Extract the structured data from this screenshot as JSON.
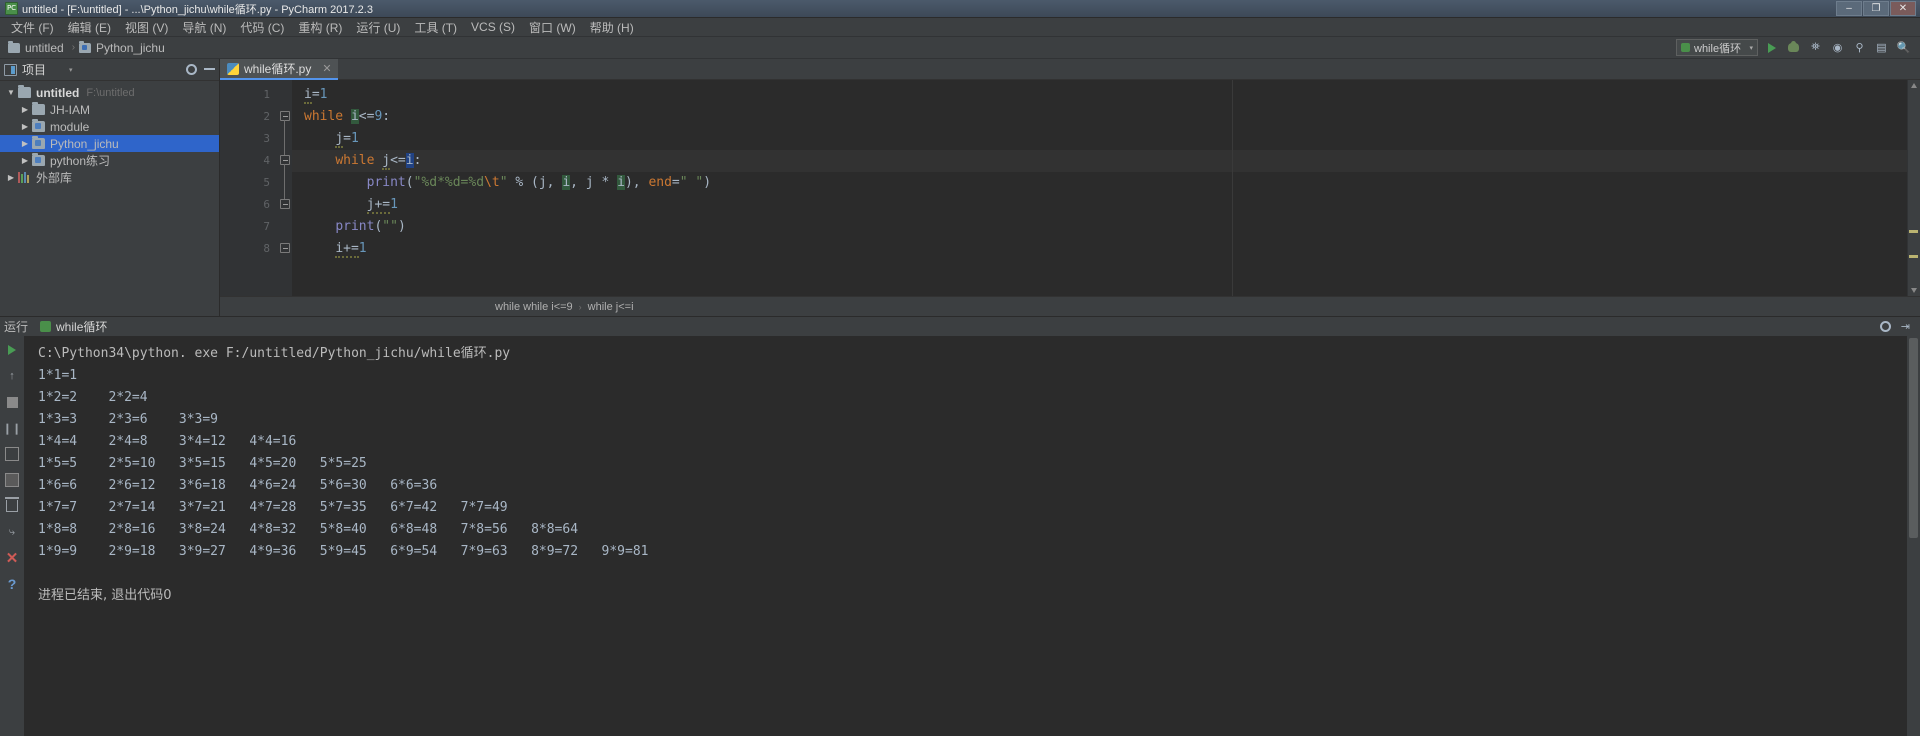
{
  "window": {
    "title": "untitled - [F:\\untitled] - ...\\Python_jichu\\while循环.py - PyCharm 2017.2.3",
    "app_icon": "pycharm-icon",
    "minimize": "–",
    "maximize": "❐",
    "close": "✕"
  },
  "menubar": {
    "items": [
      {
        "label": "文件 (F)",
        "name": "menu-file"
      },
      {
        "label": "编辑 (E)",
        "name": "menu-edit"
      },
      {
        "label": "视图 (V)",
        "name": "menu-view"
      },
      {
        "label": "导航 (N)",
        "name": "menu-navigate"
      },
      {
        "label": "代码 (C)",
        "name": "menu-code"
      },
      {
        "label": "重构 (R)",
        "name": "menu-refactor"
      },
      {
        "label": "运行 (U)",
        "name": "menu-run"
      },
      {
        "label": "工具 (T)",
        "name": "menu-tools"
      },
      {
        "label": "VCS (S)",
        "name": "menu-vcs"
      },
      {
        "label": "窗口 (W)",
        "name": "menu-window"
      },
      {
        "label": "帮助 (H)",
        "name": "menu-help"
      }
    ]
  },
  "navbar": {
    "crumbs": [
      {
        "label": "untitled",
        "icon": "folder-icon"
      },
      {
        "label": "Python_jichu",
        "icon": "source-folder-icon"
      }
    ],
    "separator": "›",
    "run_config": {
      "label": "while循环",
      "icon": "python-config-icon",
      "arrow": "▾"
    },
    "buttons": [
      {
        "name": "run-button",
        "icon": "play-icon"
      },
      {
        "name": "debug-button",
        "icon": "bug-icon"
      },
      {
        "name": "coverage-button",
        "icon": "coverage-icon"
      },
      {
        "name": "profile-button",
        "icon": "profile-icon"
      },
      {
        "name": "attach-button",
        "icon": "attach-icon"
      },
      {
        "name": "layout-button",
        "icon": "layout-icon"
      },
      {
        "name": "search-button",
        "icon": "search-icon"
      }
    ]
  },
  "sidebar": {
    "header": {
      "title": "项目",
      "caret": "▾",
      "icon": "project-panel-icon",
      "settings_icon": "gear-icon",
      "collapse_icon": "collapse-icon"
    },
    "tree": [
      {
        "label": "untitled",
        "sub": "F:\\untitled",
        "icon": "folder-icon",
        "twisty": "▼",
        "depth": 0,
        "bold": true,
        "selected": false
      },
      {
        "label": "JH-IAM",
        "sub": "",
        "icon": "folder-icon",
        "twisty": "▶",
        "depth": 1,
        "bold": false,
        "selected": false
      },
      {
        "label": "module",
        "sub": "",
        "icon": "source-folder-icon",
        "twisty": "▶",
        "depth": 1,
        "bold": false,
        "selected": false
      },
      {
        "label": "Python_jichu",
        "sub": "",
        "icon": "source-folder-icon",
        "twisty": "▶",
        "depth": 1,
        "bold": false,
        "selected": true
      },
      {
        "label": "python练习",
        "sub": "",
        "icon": "source-folder-icon",
        "twisty": "▶",
        "depth": 1,
        "bold": false,
        "selected": false
      },
      {
        "label": "外部库",
        "sub": "",
        "icon": "library-icon",
        "twisty": "▶",
        "depth": 0,
        "bold": false,
        "selected": false
      }
    ]
  },
  "editor": {
    "tab": {
      "label": "while循环.py",
      "icon": "python-file-icon",
      "close": "✕"
    },
    "gutter_lines": [
      "1",
      "2",
      "3",
      "4",
      "5",
      "6",
      "7",
      "8"
    ],
    "code": [
      {
        "n": 1,
        "text": "i=1",
        "current": false
      },
      {
        "n": 2,
        "text": "while i<=9:",
        "current": false
      },
      {
        "n": 3,
        "text": "    j=1",
        "current": false
      },
      {
        "n": 4,
        "text": "    while j<=i:",
        "current": true
      },
      {
        "n": 5,
        "text": "        print(\"%d*%d=%d\\t\" % (j, i, j * i), end=\" \")",
        "current": false
      },
      {
        "n": 6,
        "text": "        j+=1",
        "current": false
      },
      {
        "n": 7,
        "text": "    print(\"\")",
        "current": false
      },
      {
        "n": 8,
        "text": "    i+=1",
        "current": false
      }
    ],
    "breadcrumb": [
      "while i<=9",
      "while j<=i"
    ],
    "breadcrumb_separator": "›"
  },
  "run_panel": {
    "label": "运行",
    "tab_label": "while循环",
    "tab_icon": "python-run-icon",
    "settings_icon": "gear-icon",
    "hide_icon": "hide-icon",
    "toolbar": [
      {
        "name": "rerun-button",
        "icon": "play-icon"
      },
      {
        "name": "scroll-up-button",
        "icon": "arrow-up-icon"
      },
      {
        "name": "stop-button",
        "icon": "stop-icon"
      },
      {
        "name": "pause-button",
        "icon": "pause-icon"
      },
      {
        "name": "wrap-button",
        "icon": "wrap-icon"
      },
      {
        "name": "print-button",
        "icon": "print-icon"
      },
      {
        "name": "camera-button",
        "icon": "camera-icon"
      },
      {
        "name": "soft-wrap-button",
        "icon": "soft-wrap-icon"
      },
      {
        "name": "clear-all-button",
        "icon": "trash-icon"
      },
      {
        "name": "close-button",
        "icon": "close-icon"
      },
      {
        "name": "help-button",
        "icon": "question-icon"
      }
    ],
    "console": [
      "C:\\Python34\\python. exe F:/untitled/Python_jichu/while循环.py",
      "1*1=1",
      "1*2=2    2*2=4",
      "1*3=3    2*3=6    3*3=9",
      "1*4=4    2*4=8    3*4=12   4*4=16",
      "1*5=5    2*5=10   3*5=15   4*5=20   5*5=25",
      "1*6=6    2*6=12   3*6=18   4*6=24   5*6=30   6*6=36",
      "1*7=7    2*7=14   3*7=21   4*7=28   5*7=35   6*7=42   7*7=49",
      "1*8=8    2*8=16   3*8=24   4*8=32   5*8=40   6*8=48   7*8=56   8*8=64",
      "1*9=9    2*9=18   3*9=27   4*9=36   5*9=45   6*9=54   7*9=63   8*9=72   9*9=81",
      "",
      "进程已结束, 退出代码0"
    ]
  },
  "colors": {
    "accent": "#5394ec",
    "selection": "#2f65ca",
    "keyword": "#cc7832",
    "string": "#6a8759",
    "number": "#6897bb",
    "function": "#8888c6",
    "editor_bg": "#2b2b2b",
    "panel_bg": "#3c3f41"
  }
}
